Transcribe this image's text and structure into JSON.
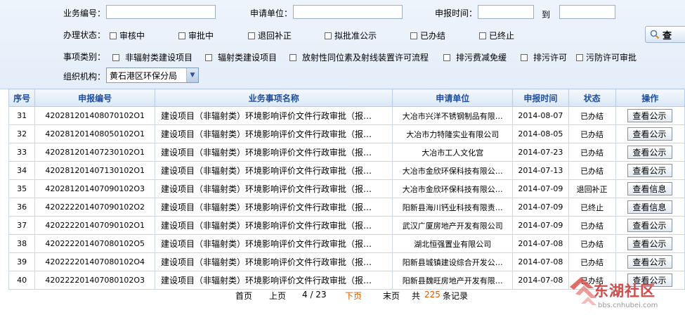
{
  "filters": {
    "business_no_label": "业务编号：",
    "apply_unit_label": "申请单位：",
    "report_time_label": "申报时间：",
    "to_label": "到",
    "status_label": "办理状态：",
    "status_options": [
      "审核中",
      "审批中",
      "退回补正",
      "拟批准公示",
      "已办结",
      "已终止"
    ],
    "category_label": "事项类别：",
    "category_options": [
      "非辐射类建设项目",
      "辐射类建设项目",
      "放射性同位素及射线装置许可流程",
      "排污费减免缓",
      "排污许可",
      "污防许可审批"
    ],
    "org_label": "组织机构：",
    "org_selected": "黄石港区环保分局",
    "query_label": "查"
  },
  "table": {
    "columns": [
      "序号",
      "申报编号",
      "业务事项名称",
      "申请单位",
      "申报时间",
      "状态",
      "操作"
    ],
    "rows": [
      {
        "no": "31",
        "code": "420281201408070102O1",
        "name": "建设项目（非辐射类）环境影响评价文件行政审批（报…",
        "unit": "大冶市兴洋不锈钢制品有限…",
        "date": "2014-08-07",
        "status": "已办结",
        "action": "查看公示"
      },
      {
        "no": "32",
        "code": "420281201408050102O1",
        "name": "建设项目（非辐射类）环境影响评价文件行政审批（报…",
        "unit": "大冶市力特隆实业有限公司",
        "date": "2014-08-05",
        "status": "已办结",
        "action": "查看公示"
      },
      {
        "no": "33",
        "code": "420281201407230102O1",
        "name": "建设项目（非辐射类）环境影响评价文件行政审批（报…",
        "unit": "大冶市工人文化宫",
        "date": "2014-07-23",
        "status": "已办结",
        "action": "查看公示"
      },
      {
        "no": "34",
        "code": "420281201407130102O1",
        "name": "建设项目（非辐射类）环境影响评价文件行政审批（报…",
        "unit": "大冶市金欣环保科技有限公…",
        "date": "2014-07-13",
        "status": "已办结",
        "action": "查看公示"
      },
      {
        "no": "35",
        "code": "420281201407090102O3",
        "name": "建设项目（非辐射类）环境影响评价文件行政审批（报…",
        "unit": "大冶市金欣环保科技有限公…",
        "date": "2014-07-09",
        "status": "退回补正",
        "action": "查看信息"
      },
      {
        "no": "36",
        "code": "420222201407090102O2",
        "name": "建设项目（非辐射类）环境影响评价文件行政审批（报…",
        "unit": "阳新县海川钙业科技有限责…",
        "date": "2014-07-09",
        "status": "已终止",
        "action": "查看信息"
      },
      {
        "no": "37",
        "code": "420222201407090102O1",
        "name": "建设项目（非辐射类）环境影响评价文件行政审批（报…",
        "unit": "武汉广厦房地产开发有限公司",
        "date": "2014-07-09",
        "status": "已办结",
        "action": "查看公示"
      },
      {
        "no": "38",
        "code": "420222201407080102O5",
        "name": "建设项目（非辐射类）环境影响评价文件行政审批（报…",
        "unit": "湖北恒强置业有限公司",
        "date": "2014-07-08",
        "status": "已办结",
        "action": "查看公示"
      },
      {
        "no": "39",
        "code": "420222201407080102O4",
        "name": "建设项目（非辐射类）环境影响评价文件行政审批（报…",
        "unit": "阳新县城镇建设综合开发公…",
        "date": "2014-07-08",
        "status": "已办结",
        "action": "查看公示"
      },
      {
        "no": "40",
        "code": "420222201407080102O3",
        "name": "建设项目（非辐射类）环境影响评价文件行政审批（报…",
        "unit": "阳新县魏旺房地产开发有限…",
        "date": "2014-07-08",
        "status": "已办结",
        "action": "查看公示"
      }
    ]
  },
  "pager": {
    "first": "首页",
    "prev": "上页",
    "page": "4 / 23",
    "next": "下页",
    "last": "末页",
    "total_prefix": "共",
    "total": "225",
    "total_suffix": "条记录"
  },
  "watermark": {
    "site_name": "东湖社区",
    "url": "bbs.cnhubei.com"
  },
  "colors": {
    "header_text": "#1f4e9a",
    "pager_highlight": "#e05a00",
    "watermark": "#cc4b4b"
  }
}
